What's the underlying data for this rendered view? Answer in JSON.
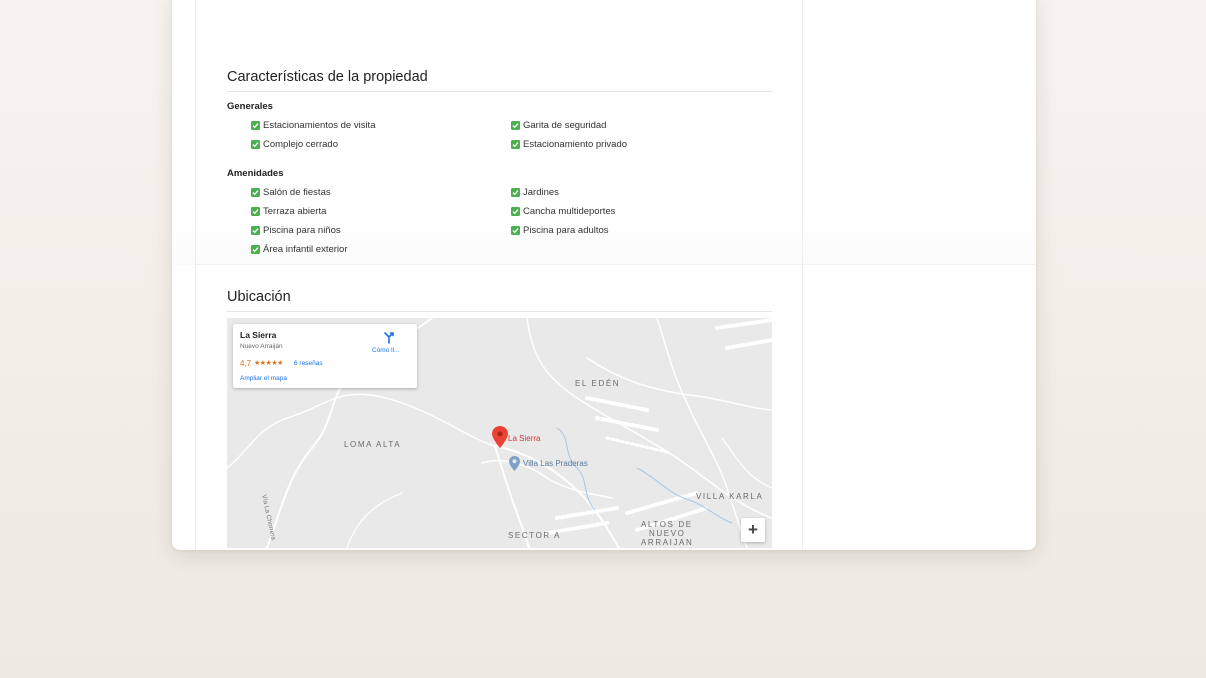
{
  "characteristics": {
    "title": "Características de la propiedad",
    "groups": [
      {
        "title": "Generales",
        "items": [
          "Estacionamientos de visita",
          "Garita de seguridad",
          "Complejo cerrado",
          "Estacionamiento privado"
        ]
      },
      {
        "title": "Amenidades",
        "items": [
          "Salón de fiestas",
          "Jardines",
          "Terraza abierta",
          "Cancha multideportes",
          "Piscina para niños",
          "Piscina para adultos",
          "Área infantil exterior"
        ]
      }
    ]
  },
  "location": {
    "title": "Ubicación",
    "map": {
      "place_name": "La Sierra",
      "place_area": "Nuevo Arraiján",
      "rating": "4,7",
      "stars": "★★★★★",
      "reviews": "6 reseñas",
      "enlarge_link": "Ampliar el mapa",
      "directions_label": "Cómo ll...",
      "pin_label": "La Sierra",
      "poi_label": "Villa Las Praderas",
      "zoom_in": "+",
      "area_labels": {
        "el_eden": "EL EDÉN",
        "loma_alta": "LOMA ALTA",
        "villa_karla": "VILLA KARLA",
        "altos_1": "ALTOS DE",
        "altos_2": "NUEVO",
        "altos_3": "ARRAIJAN",
        "sector_a": "SECTOR A"
      },
      "road_label": "Vía La Chorrera"
    }
  },
  "colors": {
    "check": "#4caf50",
    "pin": "#db3236",
    "link": "#1a73e8",
    "rating": "#e7711b"
  }
}
